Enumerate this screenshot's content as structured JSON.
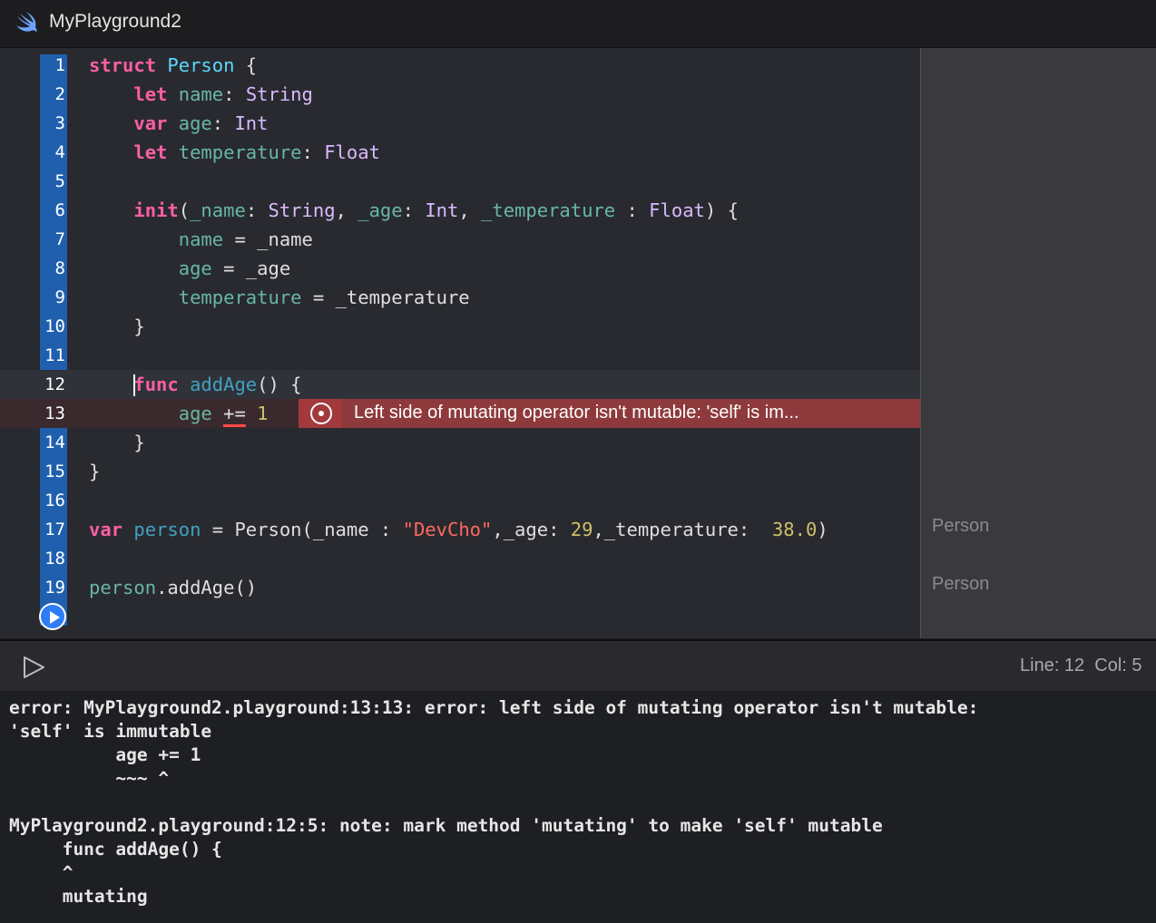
{
  "window": {
    "title": "MyPlayground2"
  },
  "editor": {
    "line_numbers": [
      "1",
      "2",
      "3",
      "4",
      "5",
      "6",
      "7",
      "8",
      "9",
      "10",
      "11",
      "12",
      "13",
      "14",
      "15",
      "16",
      "17",
      "18",
      "19"
    ],
    "error_message": "Left side of mutating operator isn't mutable: 'self' is im..."
  },
  "results": {
    "line17": "Person",
    "line19": "Person"
  },
  "debug": {
    "line": "Line: 12",
    "col": "Col: 5"
  },
  "console": {
    "lines": [
      "error: MyPlayground2.playground:13:13: error: left side of mutating operator isn't mutable:",
      "'self' is immutable",
      "          age += 1",
      "          ~~~ ^",
      "",
      "MyPlayground2.playground:12:5: note: mark method 'mutating' to make 'self' mutable",
      "     func addAge() {",
      "     ^",
      "     mutating"
    ]
  },
  "colors": {
    "keyword": "#fc5fa3",
    "type": "#dabaff",
    "property": "#67b7a4",
    "string": "#fc6a5d",
    "number": "#d0bf69",
    "error": "#8e3a3c",
    "gutter": "#1f5fae"
  },
  "icons": {
    "app": "swift-icon",
    "run": "play-circle-icon",
    "console_run": "play-outline-icon",
    "error": "error-icon"
  }
}
